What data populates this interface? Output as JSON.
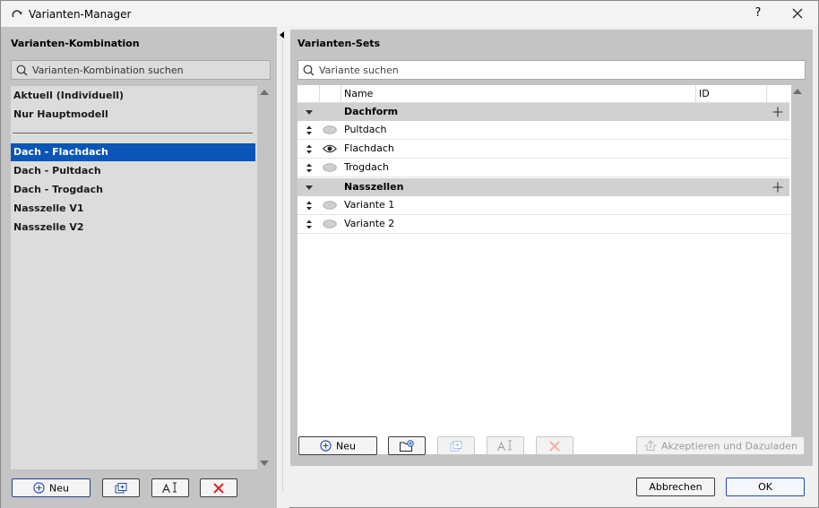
{
  "window": {
    "title": "Varianten-Manager",
    "help_label": "?"
  },
  "left": {
    "title": "Varianten-Kombination",
    "search_placeholder": "Varianten-Kombination suchen",
    "items_top": [
      "Aktuell (Individuell)",
      "Nur Hauptmodell"
    ],
    "items": [
      "Dach - Flachdach",
      "Dach - Pultdach",
      "Dach - Trogdach",
      "Nasszelle V1",
      "Nasszelle V2"
    ],
    "selected_item": "Dach - Flachdach",
    "new_label": "Neu"
  },
  "right": {
    "title": "Varianten-Sets",
    "search_placeholder": "Variante suchen",
    "columns": {
      "name": "Name",
      "id": "ID"
    },
    "groups": [
      {
        "name": "Dachform",
        "items": [
          {
            "name": "Pultdach",
            "visible": false
          },
          {
            "name": "Flachdach",
            "visible": true
          },
          {
            "name": "Trogdach",
            "visible": false
          }
        ]
      },
      {
        "name": "Nasszellen",
        "items": [
          {
            "name": "Variante 1",
            "visible": false
          },
          {
            "name": "Variante 2",
            "visible": false
          }
        ]
      }
    ],
    "new_label": "Neu",
    "accept_label": "Akzeptieren und Dazuladen"
  },
  "footer": {
    "cancel_label": "Abbrechen",
    "ok_label": "OK"
  },
  "colors": {
    "selection": "#0a55b5",
    "panel": "#c4c4c4",
    "delete": "#d9261c"
  }
}
